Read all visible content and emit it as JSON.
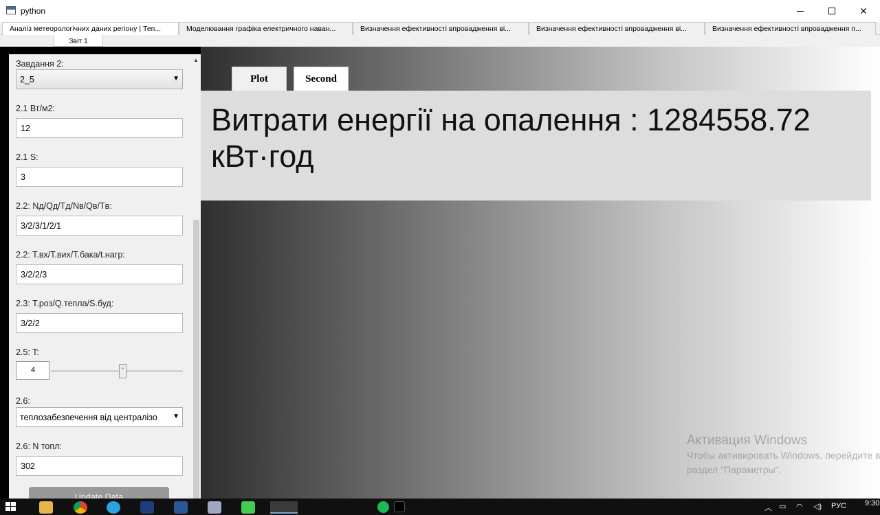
{
  "window": {
    "title": "python"
  },
  "top_tabs": [
    "Аналіз метеорологічних даних регіону | Теп...",
    "Моделювання графіка електричного наван...",
    "Визначення ефективності впровадження ві...",
    "Визначення ефективності впровадження ві...",
    "Визначення ефективності впровадження п..."
  ],
  "sub_tab": "Звіт 1",
  "form": {
    "task_label": "Завдання 2:",
    "task_value": "2_5",
    "f1_label": "2.1 Вт/м2:",
    "f1_value": "12",
    "f2_label": "2.1 S:",
    "f2_value": "3",
    "f3_label": "2.2: Nд/Qд/Tд/Nв/Qв/Tв:",
    "f3_value": "3/2/3/1/2/1",
    "f4_label": "2.2: T.вх/T.вих/T.бака/t.нагр:",
    "f4_value": "3/2/2/3",
    "f5_label": "2.3: T.роз/Q.тепла/S.буд:",
    "f5_value": "3/2/2",
    "f6_label": "2.5: T:",
    "f6_value": "4",
    "slider_fraction": 0.54,
    "f7_label": "2.6:",
    "f7_value": "теплозабезпечення від централізо",
    "f8_label": "2.6: N топл:",
    "f8_value": "302",
    "update_button": "Update Data"
  },
  "panel_tabs": {
    "plot": "Plot",
    "second": "Second"
  },
  "result": {
    "text": "Витрати енергії на опалення : 1284558.72 кВт·год"
  },
  "watermark": {
    "line1": "Активация Windows",
    "line2": "Чтобы активировать Windows, перейдите в",
    "line3": "раздел \"Параметры\"."
  },
  "taskbar": {
    "lang": "РУС",
    "time": "9:30"
  }
}
